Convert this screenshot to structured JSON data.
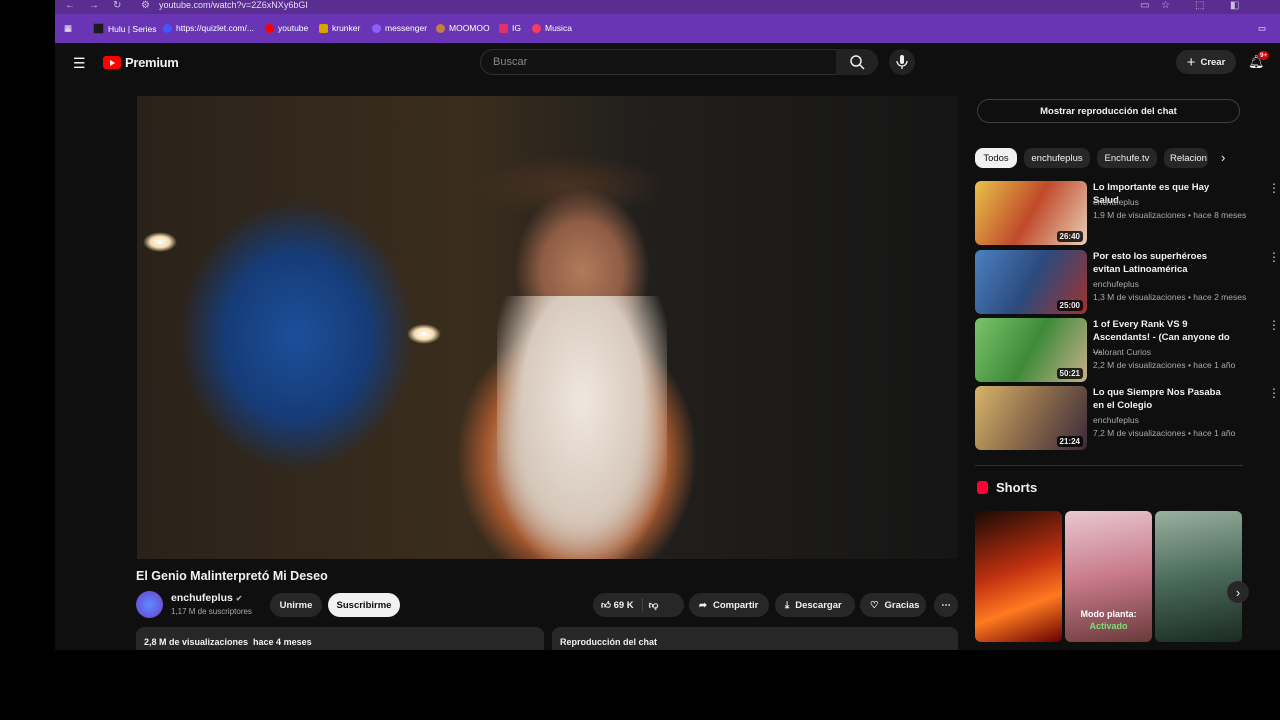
{
  "browser": {
    "url": "youtube.com/watch?v=2Z6xNXy6bGI",
    "bookmarks": [
      {
        "label": "Hulu | Series",
        "color": "#222222"
      },
      {
        "label": "https://quizlet.com/...",
        "color": "#4255ff"
      },
      {
        "label": "youtube",
        "color": "#ff0000"
      },
      {
        "label": "krunker",
        "color": "#d9a400"
      },
      {
        "label": "messenger",
        "color": "#8e5cff"
      },
      {
        "label": "MOOMOO",
        "color": "#c08040"
      },
      {
        "label": "IG",
        "color": "#e1306c"
      },
      {
        "label": "Musica",
        "color": "#ff3b5c"
      }
    ]
  },
  "header": {
    "logo_text": "Premium",
    "search_placeholder": "Buscar",
    "create_label": "Crear",
    "notif_badge": "9+"
  },
  "video": {
    "title": "El Genio Malinterpretó Mi Deseo",
    "channel": "enchufeplus",
    "subscribers": "1,17 M de suscriptores",
    "join_label": "Unirme",
    "subscribed_label": "Suscribirme",
    "likes": "69 K",
    "share_label": "Compartir",
    "download_label": "Descargar",
    "thanks_label": "Gracias",
    "views_date": "2,8 M de visualizaciones  hace 4 meses",
    "chat_replay_label": "Reproducción del chat"
  },
  "sidebar": {
    "chat_button": "Mostrar reproducción del chat",
    "chips": [
      "Todos",
      "enchufeplus",
      "Enchufe.tv",
      "Relacion"
    ],
    "related": [
      {
        "title": "Lo Importante es que Hay Salud",
        "channel": "enchufeplus",
        "meta": "1,9 M de visualizaciones • hace 8 meses",
        "duration": "26:40"
      },
      {
        "title": "Por esto los superhéroes evitan Latinoamérica",
        "channel": "enchufeplus",
        "meta": "1,3 M de visualizaciones • hace 2 meses",
        "duration": "25:00"
      },
      {
        "title": "1 of Every Rank VS 9 Ascendants! - (Can anyone do ...",
        "channel": "Valorant Curios",
        "meta": "2,2 M de visualizaciones • hace 1 año",
        "duration": "50:21"
      },
      {
        "title": "Lo que Siempre Nos Pasaba en el Colegio",
        "channel": "enchufeplus",
        "meta": "7,2 M de visualizaciones • hace 1 año",
        "duration": "21:24"
      }
    ],
    "shorts_title": "Shorts",
    "short_caption_1": "Modo planta:",
    "short_caption_2": "Activado"
  }
}
